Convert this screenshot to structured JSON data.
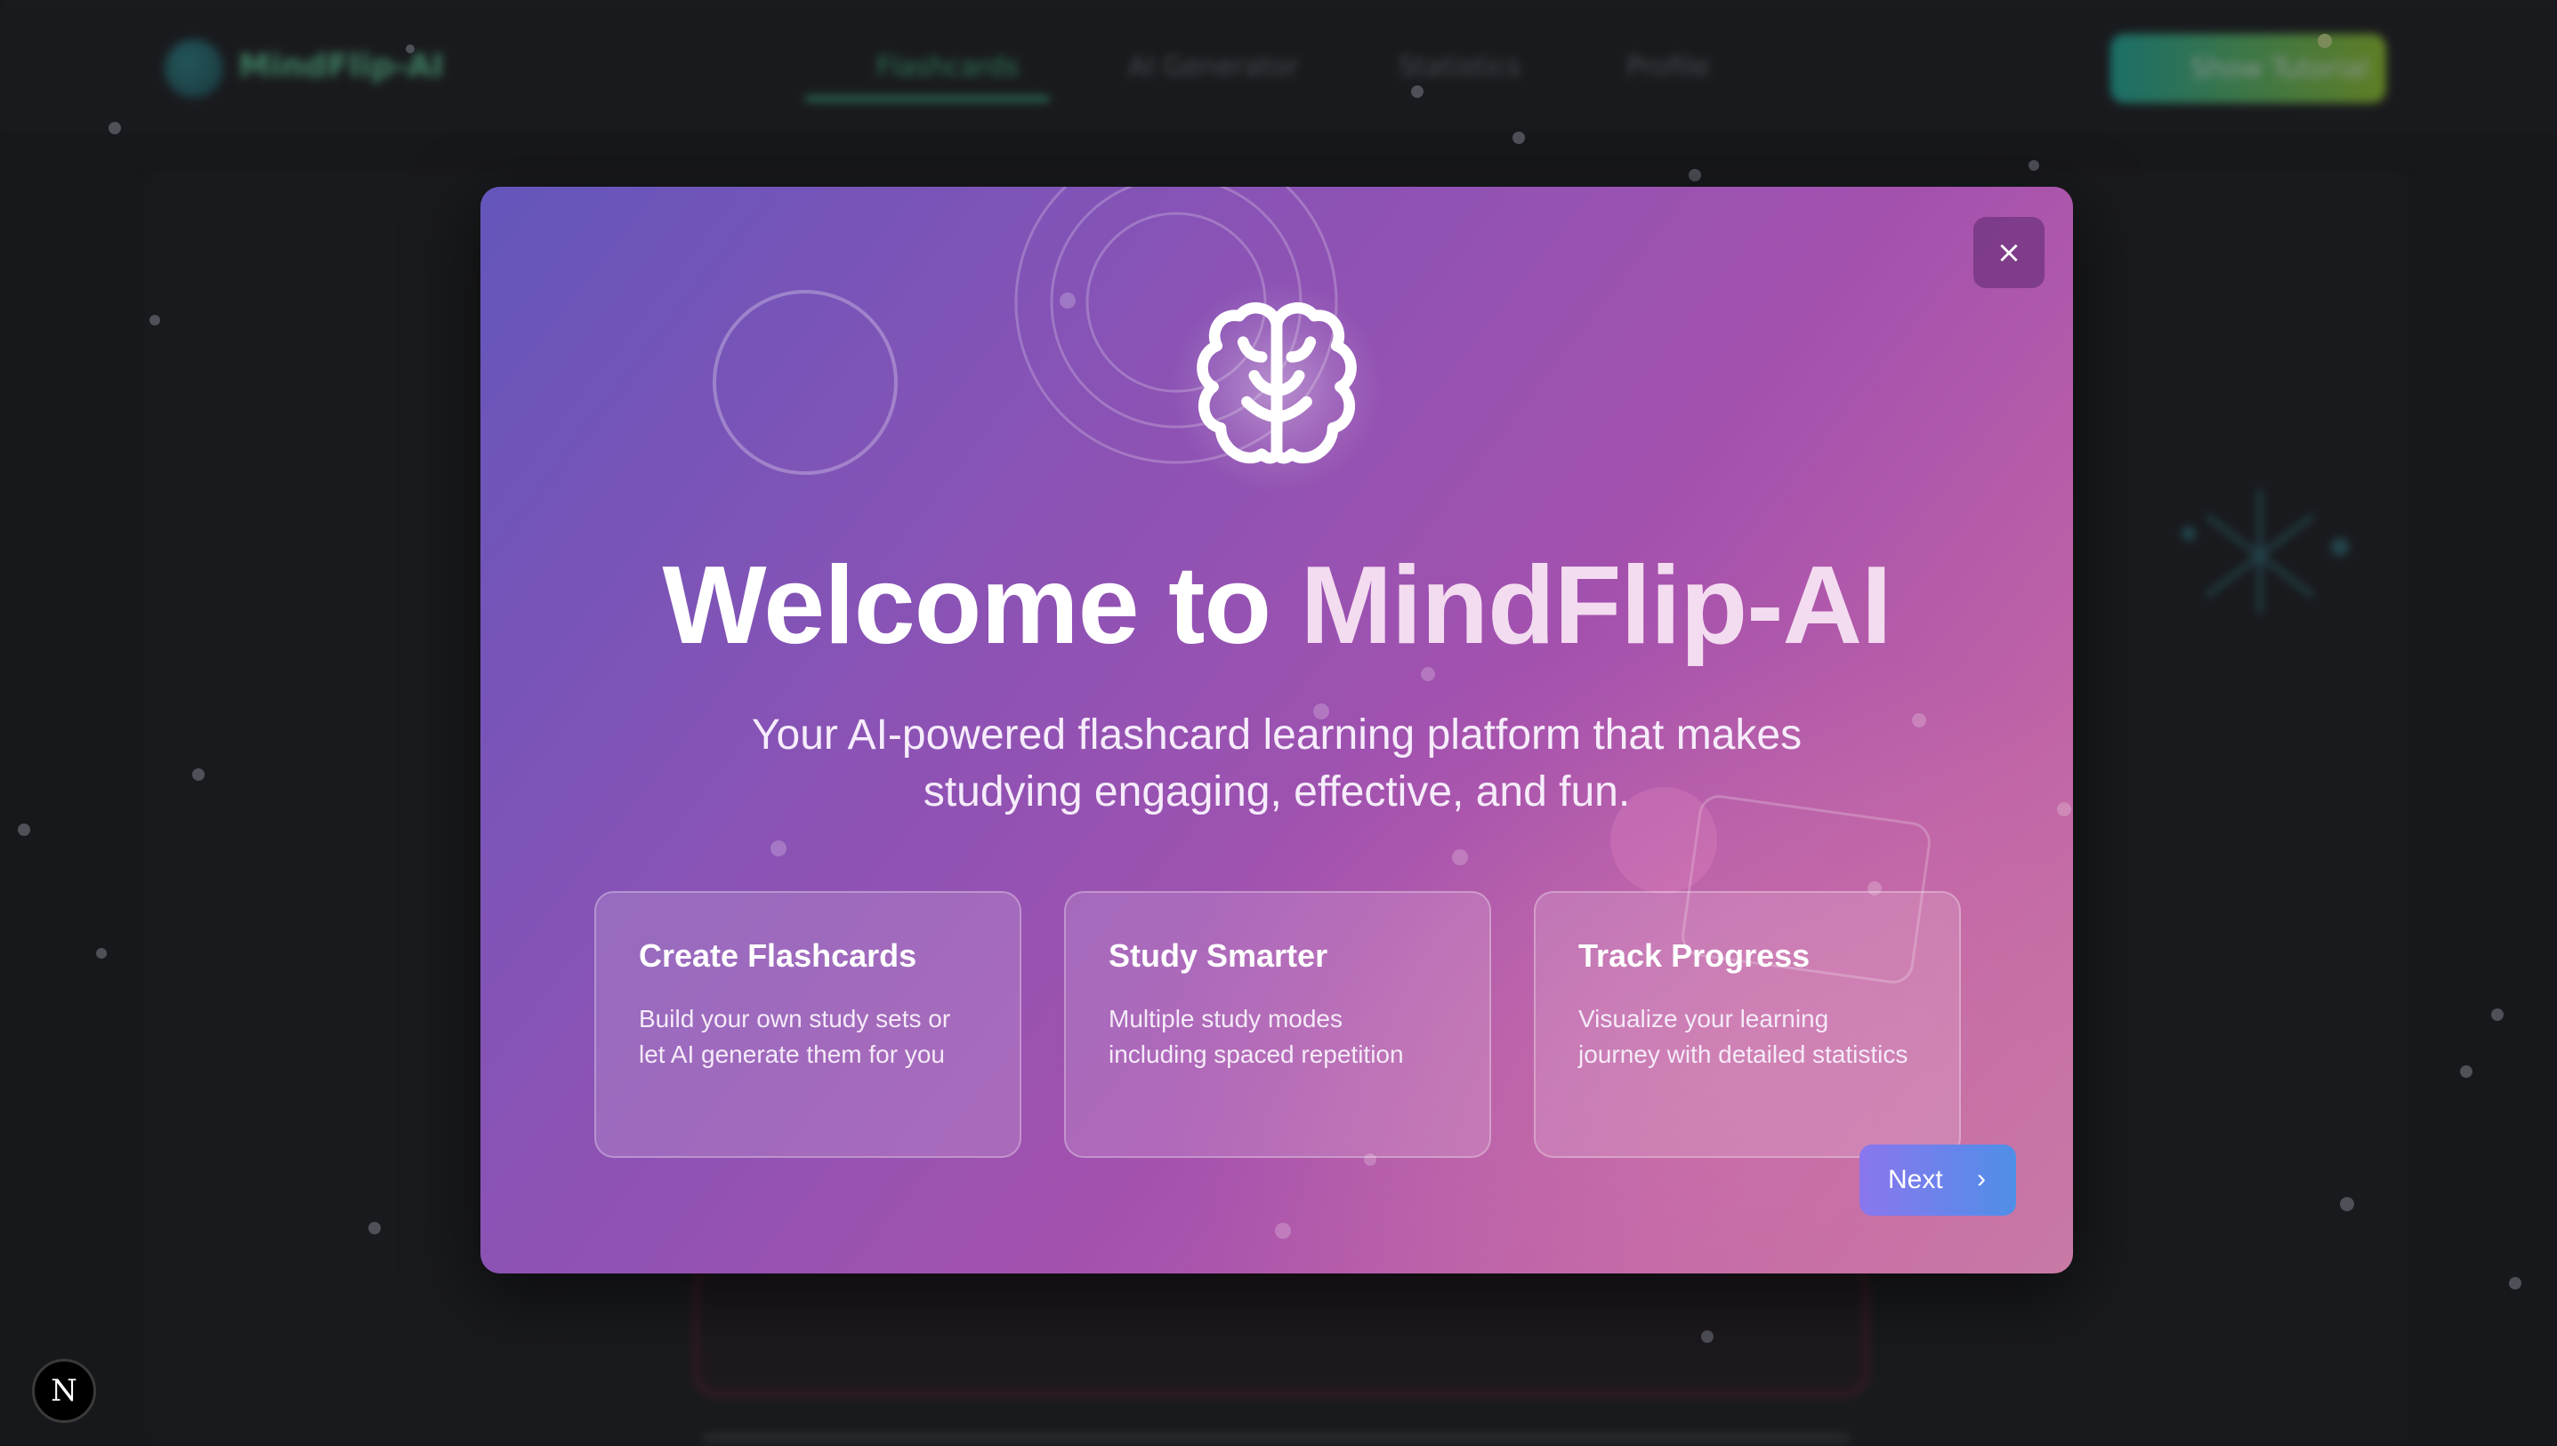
{
  "background_app": {
    "logo_text": "MindFlip-AI",
    "nav": [
      "Flashcards",
      "AI Generator",
      "Statistics",
      "Profile"
    ],
    "cta_label": "Show Tutorial"
  },
  "dev_badge": "N",
  "modal": {
    "close_glyph": "×",
    "title_part1": "Welcome to ",
    "title_part2": "MindFlip-AI",
    "subtitle": "Your AI-powered flashcard learning platform that makes studying engaging, effective, and fun.",
    "features": [
      {
        "title": "Create Flashcards",
        "description": "Build your own study sets or let AI generate them for you"
      },
      {
        "title": "Study Smarter",
        "description": "Multiple study modes including spaced repetition"
      },
      {
        "title": "Track Progress",
        "description": "Visualize your learning journey with detailed statistics"
      }
    ],
    "next_label": "Next",
    "next_glyph": "›"
  },
  "colors": {
    "modal_gradient_start": "#6456bb",
    "modal_gradient_end": "#c67aa4",
    "next_gradient_start": "#8a76ee",
    "next_gradient_end": "#4f8fe8"
  }
}
